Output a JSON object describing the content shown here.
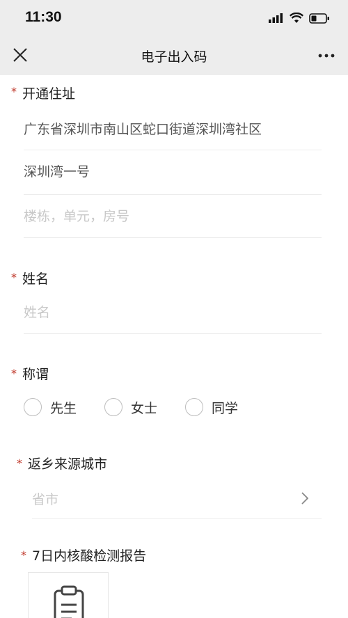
{
  "status": {
    "time": "11:30"
  },
  "nav": {
    "title": "电子出入码"
  },
  "required_mark": "*",
  "address": {
    "label": "开通住址",
    "line1": "广东省深圳市南山区蛇口街道深圳湾社区",
    "line2": "深圳湾一号",
    "unit_placeholder": "楼栋，单元，房号"
  },
  "name": {
    "label": "姓名",
    "placeholder": "姓名"
  },
  "title": {
    "label": "称谓",
    "options": [
      "先生",
      "女士",
      "同学"
    ]
  },
  "origin_city": {
    "label": "返乡来源城市",
    "placeholder": "省市"
  },
  "test_report": {
    "label": "7日内核酸检测报告"
  }
}
